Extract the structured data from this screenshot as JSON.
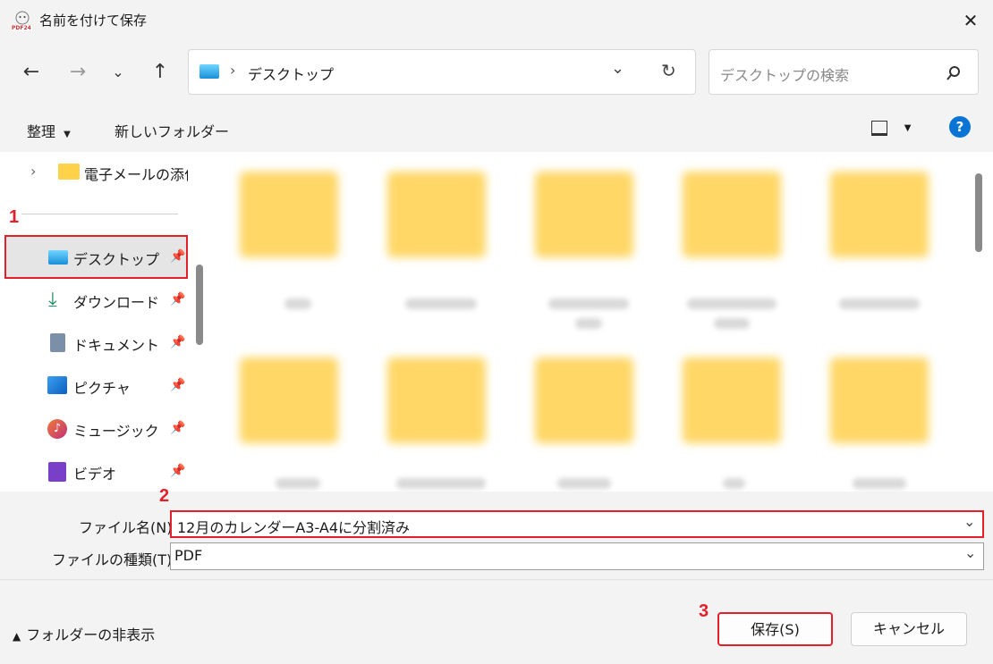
{
  "window": {
    "title": "名前を付けて保存",
    "app_icon_text": "PDF24"
  },
  "address": {
    "path_item": "デスクトップ",
    "separator": "›"
  },
  "search": {
    "placeholder": "デスクトップの検索"
  },
  "toolbar": {
    "organize_label": "整理",
    "new_folder_label": "新しいフォルダー"
  },
  "nav": {
    "top_item": "電子メールの添付",
    "items": [
      {
        "label": "デスクトップ",
        "icon": "desktop-icon"
      },
      {
        "label": "ダウンロード",
        "icon": "download-icon"
      },
      {
        "label": "ドキュメント",
        "icon": "document-icon"
      },
      {
        "label": "ピクチャ",
        "icon": "picture-icon"
      },
      {
        "label": "ミュージック",
        "icon": "music-icon"
      },
      {
        "label": "ビデオ",
        "icon": "video-icon"
      }
    ]
  },
  "form": {
    "filename_label": "ファイル名(N):",
    "filename_value": "12月のカレンダーA3-A4に分割済み",
    "filetype_label": "ファイルの種類(T):",
    "filetype_value": "PDF"
  },
  "footer": {
    "hide_folders_label": "フォルダーの非表示",
    "save_label": "保存(S)",
    "cancel_label": "キャンセル"
  },
  "markers": {
    "m1": "1",
    "m2": "2",
    "m3": "3"
  },
  "colors": {
    "highlight": "#e3202a",
    "folder": "#ffd24a",
    "accent": "#0067c0"
  }
}
